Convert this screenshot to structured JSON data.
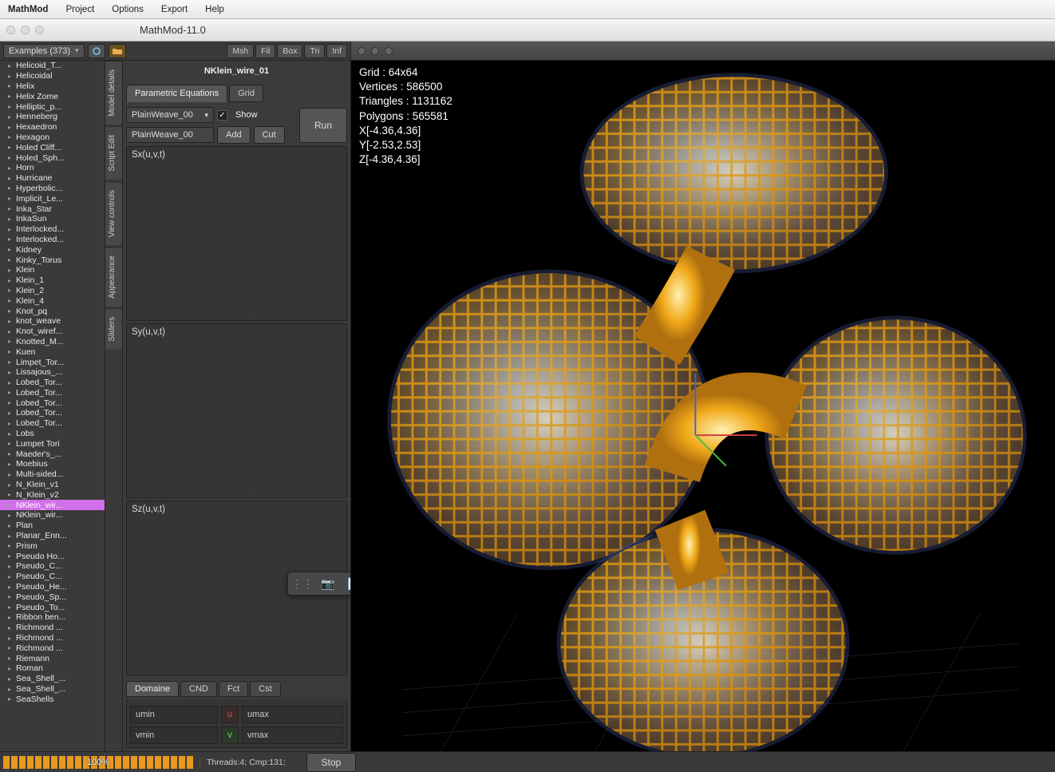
{
  "menubar": [
    "MathMod",
    "Project",
    "Options",
    "Export",
    "Help"
  ],
  "window_title": "MathMod-11.0",
  "toolbar": {
    "examples_label": "Examples (373)",
    "right_buttons": [
      "Msh",
      "Fil",
      "Box",
      "Tri",
      "Inf"
    ]
  },
  "tree_items": [
    "Helicoid_T...",
    "Helicoidal",
    "Helix",
    "Helix Zome",
    "Helliptic_p...",
    "Henneberg",
    "Hexaedron",
    "Hexagon",
    "Holed Cliff...",
    "Holed_Sph...",
    "Horn",
    "Hurricane",
    "Hyperbolic...",
    "Implicit_Le...",
    "Inka_Star",
    "InkaSun",
    "Interlocked...",
    "Interlocked...",
    "Kidney",
    "Kinky_Torus",
    "Klein",
    "Klein_1",
    "Klein_2",
    "Klein_4",
    "Knot_pq",
    "knot_weave",
    "Knot_wiref...",
    "Knotted_M...",
    "Kuen",
    "Limpet_Tor...",
    "Lissajous_...",
    "Lobed_Tor...",
    "Lobed_Tor...",
    "Lobed_Tor...",
    "Lobed_Tor...",
    "Lobed_Tor...",
    "Lobs",
    "Lumpet Tori",
    "Maeder's_...",
    "Moebius",
    "Multi-sided...",
    "N_Klein_v1",
    "N_Klein_v2",
    "NKlein_wir...",
    "NKlein_wir...",
    "Plan",
    "Planar_Enn...",
    "Prism",
    "Pseudo Ho...",
    "Pseudo_C...",
    "Pseudo_C...",
    "Pseudo_He...",
    "Pseudo_Sp...",
    "Pseudo_To...",
    "Ribbon ben...",
    "Richmond ...",
    "Richmond ...",
    "Richmond ...",
    "Riemann",
    "Roman",
    "Sea_Shell_...",
    "Sea_Shell_...",
    "SeaShells"
  ],
  "tree_selected_index": 43,
  "vtabs": [
    "Model details",
    "Script Edit",
    "View controls",
    "Appearance",
    "Sliders"
  ],
  "detail": {
    "model_name": "NKlein_wire_01",
    "top_tabs": {
      "parametric": "Parametric Equations",
      "grid": "Grid"
    },
    "dropdown": "PlainWeave_00",
    "show_label": "Show",
    "show_checked": true,
    "textfield": "PlainWeave_00",
    "add_btn": "Add",
    "cut_btn": "Cut",
    "run_btn": "Run",
    "sx": "Sx(u,v,t)",
    "sy": "Sy(u,v,t)",
    "sz": "Sz(u,v,t)",
    "bottom_tabs": [
      "Domaine",
      "CND",
      "Fct",
      "Cst"
    ],
    "domain": {
      "umin": "umin",
      "umax": "umax",
      "vmin": "vmin",
      "vmax": "vmax"
    }
  },
  "viewport_stats": {
    "grid": "Grid    : 64x64",
    "vertices": "Vertices : 586500",
    "triangles": "Triangles : 1131162",
    "polygons": "Polygons : 565581",
    "x": "X[-4.36,4.36]",
    "y": "Y[-2.53,2.53]",
    "z": "Z[-4.36,4.36]"
  },
  "bottom": {
    "progress_pct": "100%",
    "threads": "Threads:4; Cmp:131;",
    "stop": "Stop"
  },
  "colors": {
    "accent_orange": "#e8981a",
    "selection": "#d070e8"
  }
}
